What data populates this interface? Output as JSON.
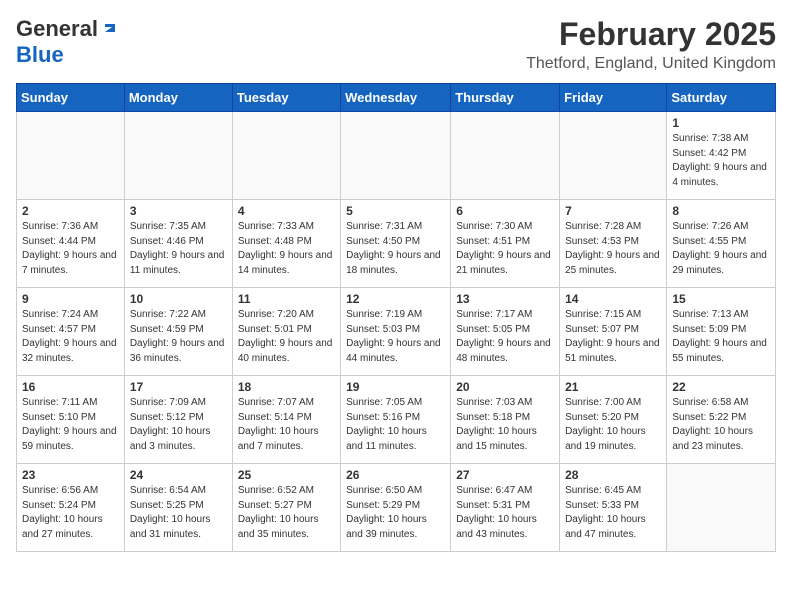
{
  "header": {
    "logo_general": "General",
    "logo_blue": "Blue",
    "title": "February 2025",
    "subtitle": "Thetford, England, United Kingdom"
  },
  "weekdays": [
    "Sunday",
    "Monday",
    "Tuesday",
    "Wednesday",
    "Thursday",
    "Friday",
    "Saturday"
  ],
  "weeks": [
    [
      {
        "day": "",
        "info": ""
      },
      {
        "day": "",
        "info": ""
      },
      {
        "day": "",
        "info": ""
      },
      {
        "day": "",
        "info": ""
      },
      {
        "day": "",
        "info": ""
      },
      {
        "day": "",
        "info": ""
      },
      {
        "day": "1",
        "info": "Sunrise: 7:38 AM\nSunset: 4:42 PM\nDaylight: 9 hours and 4 minutes."
      }
    ],
    [
      {
        "day": "2",
        "info": "Sunrise: 7:36 AM\nSunset: 4:44 PM\nDaylight: 9 hours and 7 minutes."
      },
      {
        "day": "3",
        "info": "Sunrise: 7:35 AM\nSunset: 4:46 PM\nDaylight: 9 hours and 11 minutes."
      },
      {
        "day": "4",
        "info": "Sunrise: 7:33 AM\nSunset: 4:48 PM\nDaylight: 9 hours and 14 minutes."
      },
      {
        "day": "5",
        "info": "Sunrise: 7:31 AM\nSunset: 4:50 PM\nDaylight: 9 hours and 18 minutes."
      },
      {
        "day": "6",
        "info": "Sunrise: 7:30 AM\nSunset: 4:51 PM\nDaylight: 9 hours and 21 minutes."
      },
      {
        "day": "7",
        "info": "Sunrise: 7:28 AM\nSunset: 4:53 PM\nDaylight: 9 hours and 25 minutes."
      },
      {
        "day": "8",
        "info": "Sunrise: 7:26 AM\nSunset: 4:55 PM\nDaylight: 9 hours and 29 minutes."
      }
    ],
    [
      {
        "day": "9",
        "info": "Sunrise: 7:24 AM\nSunset: 4:57 PM\nDaylight: 9 hours and 32 minutes."
      },
      {
        "day": "10",
        "info": "Sunrise: 7:22 AM\nSunset: 4:59 PM\nDaylight: 9 hours and 36 minutes."
      },
      {
        "day": "11",
        "info": "Sunrise: 7:20 AM\nSunset: 5:01 PM\nDaylight: 9 hours and 40 minutes."
      },
      {
        "day": "12",
        "info": "Sunrise: 7:19 AM\nSunset: 5:03 PM\nDaylight: 9 hours and 44 minutes."
      },
      {
        "day": "13",
        "info": "Sunrise: 7:17 AM\nSunset: 5:05 PM\nDaylight: 9 hours and 48 minutes."
      },
      {
        "day": "14",
        "info": "Sunrise: 7:15 AM\nSunset: 5:07 PM\nDaylight: 9 hours and 51 minutes."
      },
      {
        "day": "15",
        "info": "Sunrise: 7:13 AM\nSunset: 5:09 PM\nDaylight: 9 hours and 55 minutes."
      }
    ],
    [
      {
        "day": "16",
        "info": "Sunrise: 7:11 AM\nSunset: 5:10 PM\nDaylight: 9 hours and 59 minutes."
      },
      {
        "day": "17",
        "info": "Sunrise: 7:09 AM\nSunset: 5:12 PM\nDaylight: 10 hours and 3 minutes."
      },
      {
        "day": "18",
        "info": "Sunrise: 7:07 AM\nSunset: 5:14 PM\nDaylight: 10 hours and 7 minutes."
      },
      {
        "day": "19",
        "info": "Sunrise: 7:05 AM\nSunset: 5:16 PM\nDaylight: 10 hours and 11 minutes."
      },
      {
        "day": "20",
        "info": "Sunrise: 7:03 AM\nSunset: 5:18 PM\nDaylight: 10 hours and 15 minutes."
      },
      {
        "day": "21",
        "info": "Sunrise: 7:00 AM\nSunset: 5:20 PM\nDaylight: 10 hours and 19 minutes."
      },
      {
        "day": "22",
        "info": "Sunrise: 6:58 AM\nSunset: 5:22 PM\nDaylight: 10 hours and 23 minutes."
      }
    ],
    [
      {
        "day": "23",
        "info": "Sunrise: 6:56 AM\nSunset: 5:24 PM\nDaylight: 10 hours and 27 minutes."
      },
      {
        "day": "24",
        "info": "Sunrise: 6:54 AM\nSunset: 5:25 PM\nDaylight: 10 hours and 31 minutes."
      },
      {
        "day": "25",
        "info": "Sunrise: 6:52 AM\nSunset: 5:27 PM\nDaylight: 10 hours and 35 minutes."
      },
      {
        "day": "26",
        "info": "Sunrise: 6:50 AM\nSunset: 5:29 PM\nDaylight: 10 hours and 39 minutes."
      },
      {
        "day": "27",
        "info": "Sunrise: 6:47 AM\nSunset: 5:31 PM\nDaylight: 10 hours and 43 minutes."
      },
      {
        "day": "28",
        "info": "Sunrise: 6:45 AM\nSunset: 5:33 PM\nDaylight: 10 hours and 47 minutes."
      },
      {
        "day": "",
        "info": ""
      }
    ]
  ]
}
